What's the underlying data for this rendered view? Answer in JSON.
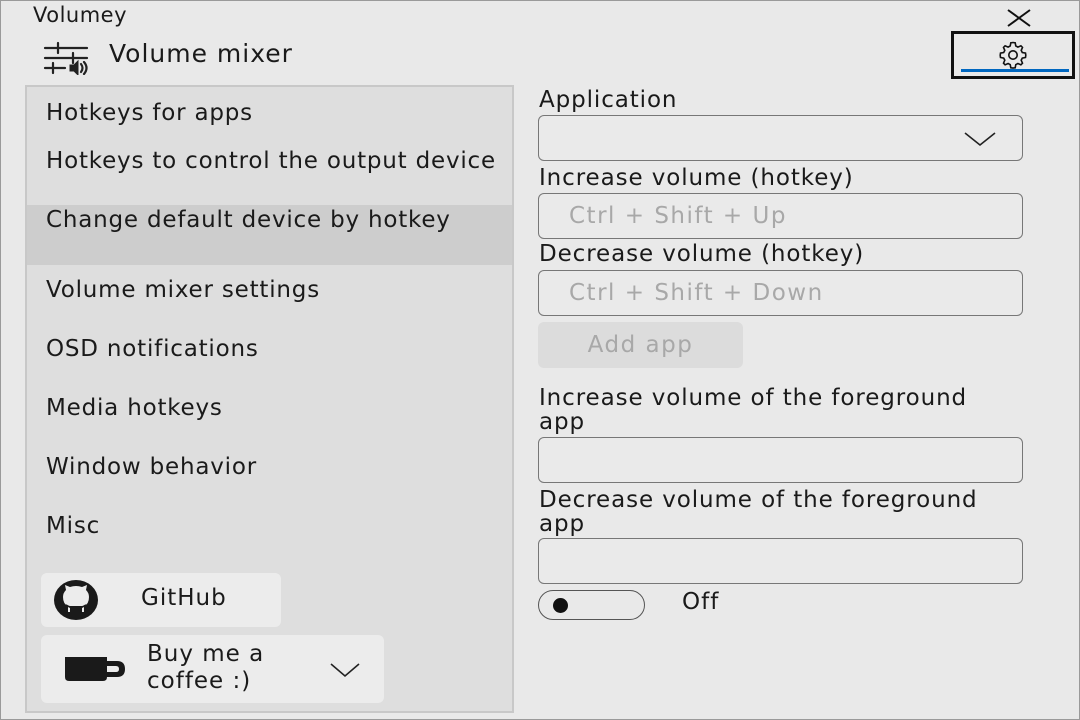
{
  "window": {
    "title": "Volumey"
  },
  "header": {
    "title": "Volume mixer",
    "icon": "mixer-sliders-icon"
  },
  "toolbar": {
    "settings_icon": "gear-icon",
    "accent": "#0067c0"
  },
  "sidebar": {
    "items": [
      {
        "label": "Hotkeys for apps"
      },
      {
        "label": "Hotkeys to control the output device"
      },
      {
        "label": "Change default device by hotkey",
        "selected": true
      },
      {
        "label": "Volume mixer settings"
      },
      {
        "label": "OSD notifications"
      },
      {
        "label": "Media hotkeys"
      },
      {
        "label": "Window behavior"
      },
      {
        "label": "Misc"
      }
    ],
    "github_label": "GitHub",
    "coffee_label": "Buy me a coffee :)"
  },
  "form": {
    "application_label": "Application",
    "application_value": "",
    "increase_label": "Increase volume (hotkey)",
    "increase_placeholder": "Ctrl + Shift + Up",
    "decrease_label": "Decrease volume (hotkey)",
    "decrease_placeholder": "Ctrl + Shift + Down",
    "add_app_label": "Add app",
    "fg_increase_label": "Increase volume of the foreground app",
    "fg_increase_value": "",
    "fg_decrease_label": "Decrease volume of the foreground app",
    "fg_decrease_value": "",
    "toggle_state": "Off"
  }
}
